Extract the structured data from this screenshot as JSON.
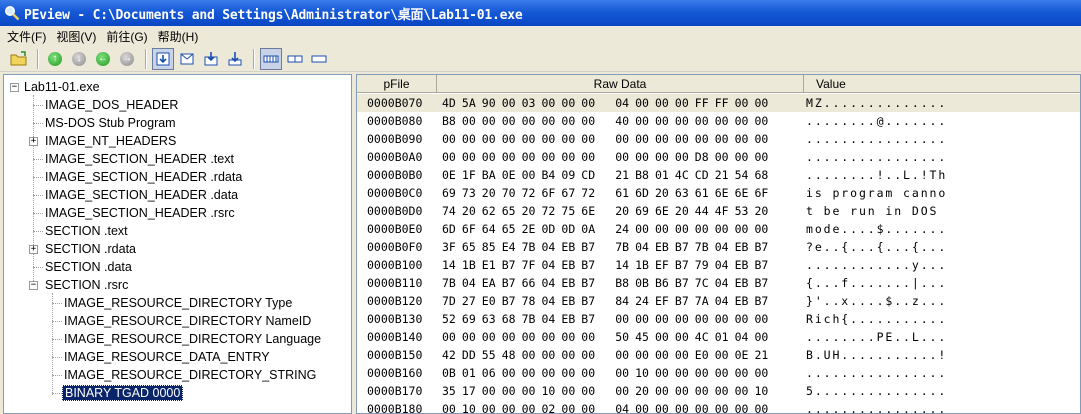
{
  "window": {
    "title": "PEview - C:\\Documents and Settings\\Administrator\\桌面\\Lab11-01.exe"
  },
  "menu": [
    "文件(F)",
    "视图(V)",
    "前往(G)",
    "帮助(H)"
  ],
  "toolbar": {
    "icons": [
      "open-icon",
      "back-icon",
      "forward-icon",
      "up-icon",
      "down-icon",
      "save-icon",
      "view-icon",
      "export-icon",
      "import-icon",
      "layout-byte-icon",
      "layout-word-icon",
      "layout-dword-icon"
    ]
  },
  "tree": {
    "root": "Lab11-01.exe",
    "items": [
      {
        "label": "IMAGE_DOS_HEADER"
      },
      {
        "label": "MS-DOS Stub Program"
      },
      {
        "label": "IMAGE_NT_HEADERS"
      },
      {
        "label": "IMAGE_SECTION_HEADER .text"
      },
      {
        "label": "IMAGE_SECTION_HEADER .rdata"
      },
      {
        "label": "IMAGE_SECTION_HEADER .data"
      },
      {
        "label": "IMAGE_SECTION_HEADER .rsrc"
      },
      {
        "label": "SECTION .text"
      },
      {
        "label": "SECTION .rdata"
      },
      {
        "label": "SECTION .data"
      },
      {
        "label": "SECTION .rsrc"
      },
      {
        "label": "IMAGE_RESOURCE_DIRECTORY Type"
      },
      {
        "label": "IMAGE_RESOURCE_DIRECTORY NameID"
      },
      {
        "label": "IMAGE_RESOURCE_DIRECTORY Language"
      },
      {
        "label": "IMAGE_RESOURCE_DATA_ENTRY"
      },
      {
        "label": "IMAGE_RESOURCE_DIRECTORY_STRING"
      },
      {
        "label": "BINARY  TGAD  0000"
      }
    ],
    "selected": "BINARY  TGAD  0000"
  },
  "hex": {
    "columns": [
      "pFile",
      "Raw Data",
      "Value"
    ],
    "rows": [
      {
        "off": "0000B070",
        "bytes": [
          "4D",
          "5A",
          "90",
          "00",
          "03",
          "00",
          "00",
          "00",
          "04",
          "00",
          "00",
          "00",
          "FF",
          "FF",
          "00",
          "00"
        ],
        "value": "MZ.............."
      },
      {
        "off": "0000B080",
        "bytes": [
          "B8",
          "00",
          "00",
          "00",
          "00",
          "00",
          "00",
          "00",
          "40",
          "00",
          "00",
          "00",
          "00",
          "00",
          "00",
          "00"
        ],
        "value": "........@......."
      },
      {
        "off": "0000B090",
        "bytes": [
          "00",
          "00",
          "00",
          "00",
          "00",
          "00",
          "00",
          "00",
          "00",
          "00",
          "00",
          "00",
          "00",
          "00",
          "00",
          "00"
        ],
        "value": "................"
      },
      {
        "off": "0000B0A0",
        "bytes": [
          "00",
          "00",
          "00",
          "00",
          "00",
          "00",
          "00",
          "00",
          "00",
          "00",
          "00",
          "00",
          "D8",
          "00",
          "00",
          "00"
        ],
        "value": "................"
      },
      {
        "off": "0000B0B0",
        "bytes": [
          "0E",
          "1F",
          "BA",
          "0E",
          "00",
          "B4",
          "09",
          "CD",
          "21",
          "B8",
          "01",
          "4C",
          "CD",
          "21",
          "54",
          "68"
        ],
        "value": "........!..L.!Th"
      },
      {
        "off": "0000B0C0",
        "bytes": [
          "69",
          "73",
          "20",
          "70",
          "72",
          "6F",
          "67",
          "72",
          "61",
          "6D",
          "20",
          "63",
          "61",
          "6E",
          "6E",
          "6F"
        ],
        "value": "is program canno"
      },
      {
        "off": "0000B0D0",
        "bytes": [
          "74",
          "20",
          "62",
          "65",
          "20",
          "72",
          "75",
          "6E",
          "20",
          "69",
          "6E",
          "20",
          "44",
          "4F",
          "53",
          "20"
        ],
        "value": "t be run in DOS "
      },
      {
        "off": "0000B0E0",
        "bytes": [
          "6D",
          "6F",
          "64",
          "65",
          "2E",
          "0D",
          "0D",
          "0A",
          "24",
          "00",
          "00",
          "00",
          "00",
          "00",
          "00",
          "00"
        ],
        "value": "mode....$......."
      },
      {
        "off": "0000B0F0",
        "bytes": [
          "3F",
          "65",
          "85",
          "E4",
          "7B",
          "04",
          "EB",
          "B7",
          "7B",
          "04",
          "EB",
          "B7",
          "7B",
          "04",
          "EB",
          "B7"
        ],
        "value": "?e..{...{...{..."
      },
      {
        "off": "0000B100",
        "bytes": [
          "14",
          "1B",
          "E1",
          "B7",
          "7F",
          "04",
          "EB",
          "B7",
          "14",
          "1B",
          "EF",
          "B7",
          "79",
          "04",
          "EB",
          "B7"
        ],
        "value": "............y..."
      },
      {
        "off": "0000B110",
        "bytes": [
          "7B",
          "04",
          "EA",
          "B7",
          "66",
          "04",
          "EB",
          "B7",
          "B8",
          "0B",
          "B6",
          "B7",
          "7C",
          "04",
          "EB",
          "B7"
        ],
        "value": "{...f.......|..."
      },
      {
        "off": "0000B120",
        "bytes": [
          "7D",
          "27",
          "E0",
          "B7",
          "78",
          "04",
          "EB",
          "B7",
          "84",
          "24",
          "EF",
          "B7",
          "7A",
          "04",
          "EB",
          "B7"
        ],
        "value": "}'..x....$..z..."
      },
      {
        "off": "0000B130",
        "bytes": [
          "52",
          "69",
          "63",
          "68",
          "7B",
          "04",
          "EB",
          "B7",
          "00",
          "00",
          "00",
          "00",
          "00",
          "00",
          "00",
          "00"
        ],
        "value": "Rich{..........."
      },
      {
        "off": "0000B140",
        "bytes": [
          "00",
          "00",
          "00",
          "00",
          "00",
          "00",
          "00",
          "00",
          "50",
          "45",
          "00",
          "00",
          "4C",
          "01",
          "04",
          "00"
        ],
        "value": "........PE..L..."
      },
      {
        "off": "0000B150",
        "bytes": [
          "42",
          "DD",
          "55",
          "48",
          "00",
          "00",
          "00",
          "00",
          "00",
          "00",
          "00",
          "00",
          "E0",
          "00",
          "0E",
          "21"
        ],
        "value": "B.UH...........!"
      },
      {
        "off": "0000B160",
        "bytes": [
          "0B",
          "01",
          "06",
          "00",
          "00",
          "00",
          "00",
          "00",
          "00",
          "10",
          "00",
          "00",
          "00",
          "00",
          "00",
          "00"
        ],
        "value": "................"
      },
      {
        "off": "0000B170",
        "bytes": [
          "35",
          "17",
          "00",
          "00",
          "00",
          "10",
          "00",
          "00",
          "00",
          "20",
          "00",
          "00",
          "00",
          "00",
          "00",
          "10"
        ],
        "value": "5..............."
      },
      {
        "off": "0000B180",
        "bytes": [
          "00",
          "10",
          "00",
          "00",
          "00",
          "02",
          "00",
          "00",
          "04",
          "00",
          "00",
          "00",
          "00",
          "00",
          "00",
          "00"
        ],
        "value": "................"
      }
    ]
  }
}
